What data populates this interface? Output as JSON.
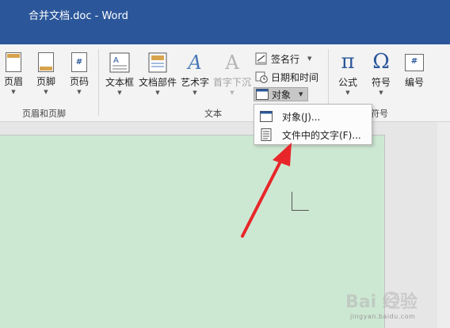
{
  "window": {
    "title": "合并文档.doc - Word"
  },
  "ribbon": {
    "header_footer_group": {
      "label": "页眉和页脚",
      "buttons": [
        {
          "label": "页眉",
          "icon": "header-page-icon"
        },
        {
          "label": "页脚",
          "icon": "footer-page-icon"
        },
        {
          "label": "页码",
          "icon": "page-number-icon",
          "glyph": "#"
        }
      ]
    },
    "text_group": {
      "label": "文本",
      "buttons": [
        {
          "label": "文本框",
          "icon": "textbox-icon"
        },
        {
          "label": "文档部件",
          "icon": "quick-parts-icon"
        },
        {
          "label": "艺术字",
          "icon": "wordart-icon",
          "glyph": "A"
        },
        {
          "label": "首字下沉",
          "icon": "drop-cap-icon",
          "glyph": "A",
          "disabled": true
        }
      ],
      "small_buttons": [
        {
          "label": "签名行",
          "icon": "signature-line-icon",
          "has_arrow": true
        },
        {
          "label": "日期和时间",
          "icon": "date-time-icon"
        },
        {
          "label": "对象",
          "icon": "object-icon",
          "has_arrow": true,
          "selected": true
        }
      ]
    },
    "symbols_group": {
      "label": "符号",
      "buttons": [
        {
          "label": "公式",
          "icon": "equation-icon",
          "glyph": "π"
        },
        {
          "label": "符号",
          "icon": "symbol-icon",
          "glyph": "Ω"
        },
        {
          "label": "编号",
          "icon": "numbering-icon",
          "glyph": "#"
        }
      ]
    }
  },
  "dropdown_menu": {
    "items": [
      {
        "label": "对象(J)...",
        "icon": "object-window-icon"
      },
      {
        "label": "文件中的文字(F)...",
        "icon": "text-from-file-icon"
      }
    ]
  },
  "colors": {
    "title_bar": "#2b579a",
    "ribbon": "#f3f3f3",
    "page": "#cde8d2",
    "annotation_arrow": "#e8262a"
  },
  "watermark": {
    "text": "Bai 经验",
    "url_text": "jingyan.baidu.com"
  }
}
